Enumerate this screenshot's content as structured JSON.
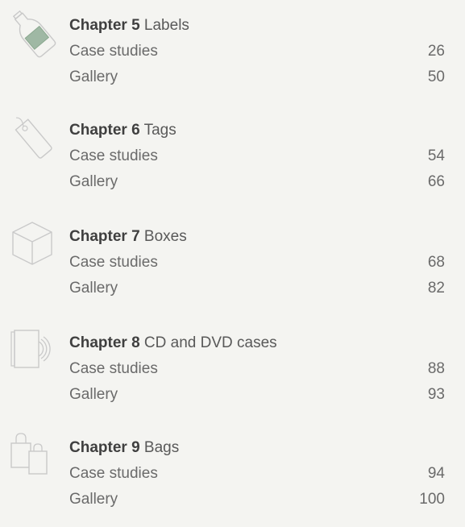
{
  "chapters": [
    {
      "number_label": "Chapter 5",
      "title": "Labels",
      "icon": "bottle-icon",
      "entries": [
        {
          "label": "Case studies",
          "page": "26"
        },
        {
          "label": "Gallery",
          "page": "50"
        }
      ]
    },
    {
      "number_label": "Chapter 6",
      "title": "Tags",
      "icon": "tag-icon",
      "entries": [
        {
          "label": "Case studies",
          "page": "54"
        },
        {
          "label": "Gallery",
          "page": "66"
        }
      ]
    },
    {
      "number_label": "Chapter 7",
      "title": "Boxes",
      "icon": "box-icon",
      "entries": [
        {
          "label": "Case studies",
          "page": "68"
        },
        {
          "label": "Gallery",
          "page": "82"
        }
      ]
    },
    {
      "number_label": "Chapter 8",
      "title": "CD and DVD cases",
      "icon": "cd-case-icon",
      "entries": [
        {
          "label": "Case studies",
          "page": "88"
        },
        {
          "label": "Gallery",
          "page": "93"
        }
      ]
    },
    {
      "number_label": "Chapter 9",
      "title": "Bags",
      "icon": "bag-icon",
      "entries": [
        {
          "label": "Case studies",
          "page": "94"
        },
        {
          "label": "Gallery",
          "page": "100"
        }
      ]
    }
  ]
}
